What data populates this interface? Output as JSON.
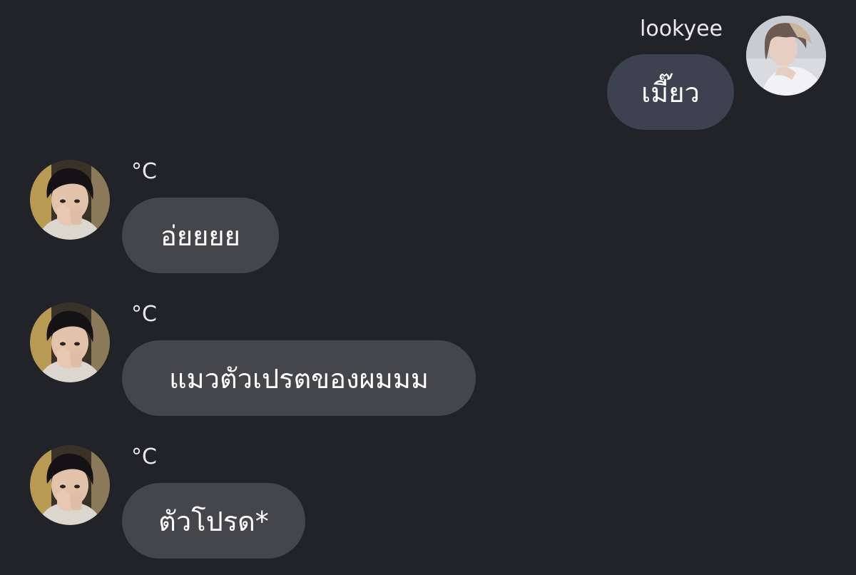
{
  "messages": [
    {
      "sender": "lookyee",
      "text": "เมี๊ยว",
      "direction": "outgoing"
    },
    {
      "sender": "°C",
      "text": "อ่ยยยย",
      "direction": "incoming"
    },
    {
      "sender": "°C",
      "text": "แมวตัวเปรตของผมมม",
      "direction": "incoming"
    },
    {
      "sender": "°C",
      "text": "ตัวโปรด*",
      "direction": "incoming"
    }
  ],
  "colors": {
    "background": "#222329",
    "outgoing_bubble": "#3c4250",
    "incoming_bubble": "#45464c",
    "text": "#ffffff"
  }
}
